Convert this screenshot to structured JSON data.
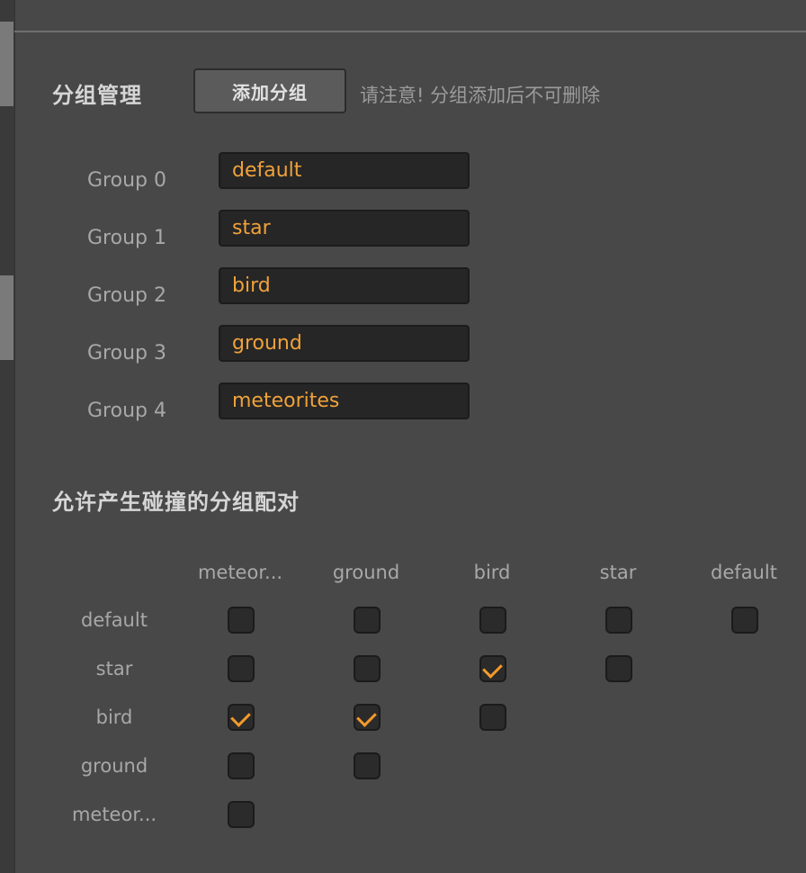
{
  "group_management": {
    "title": "分组管理",
    "add_button_label": "添加分组",
    "notice": "请注意! 分组添加后不可删除"
  },
  "groups": [
    {
      "label": "Group 0",
      "value": "default"
    },
    {
      "label": "Group 1",
      "value": "star"
    },
    {
      "label": "Group 2",
      "value": "bird"
    },
    {
      "label": "Group 3",
      "value": "ground"
    },
    {
      "label": "Group 4",
      "value": "meteorites"
    }
  ],
  "collision_matrix": {
    "title": "允许产生碰撞的分组配对",
    "columns": [
      "meteor...",
      "ground",
      "bird",
      "star",
      "default"
    ],
    "rows": [
      "default",
      "star",
      "bird",
      "ground",
      "meteor..."
    ],
    "cells": [
      [
        false,
        false,
        false,
        false,
        false
      ],
      [
        false,
        false,
        true,
        false
      ],
      [
        true,
        true,
        false
      ],
      [
        false,
        false
      ],
      [
        false
      ]
    ]
  },
  "colors": {
    "accent": "#f39a2b",
    "input_text": "#f0a23a",
    "background": "#484848"
  }
}
